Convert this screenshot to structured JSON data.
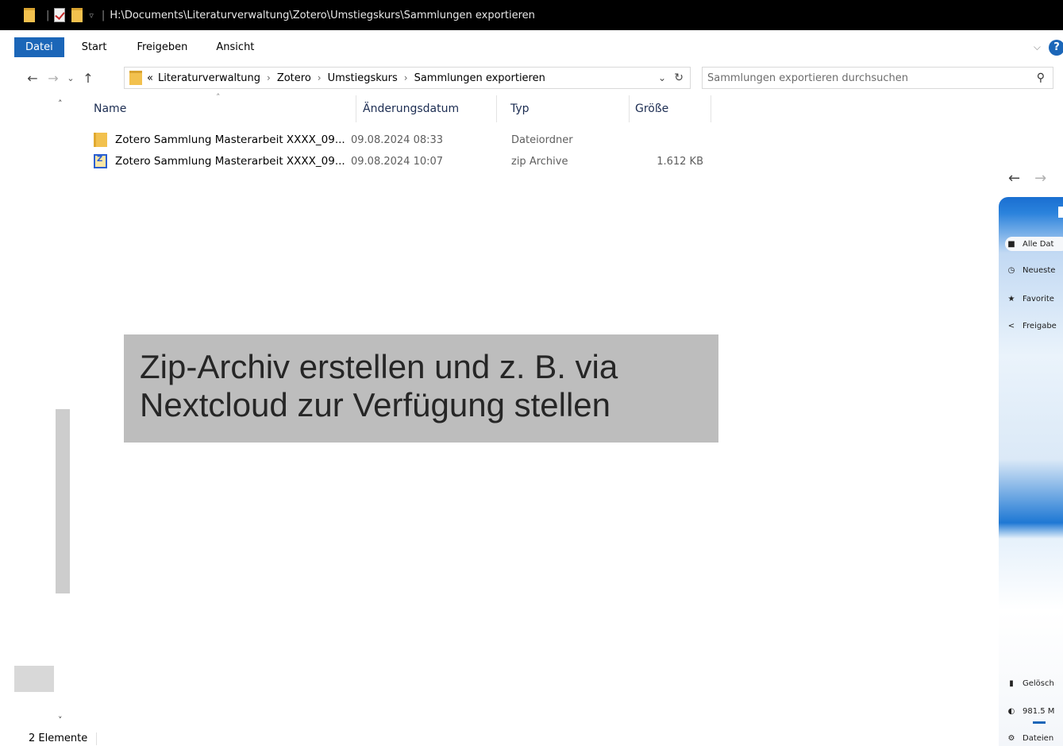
{
  "window": {
    "path": "H:\\Documents\\Literaturverwaltung\\Zotero\\Umstiegskurs\\Sammlungen exportieren"
  },
  "ribbon": {
    "tabs": [
      "Datei",
      "Start",
      "Freigeben",
      "Ansicht"
    ],
    "help": "?"
  },
  "address": {
    "overflow": "«",
    "crumbs": [
      "Literaturverwaltung",
      "Zotero",
      "Umstiegskurs",
      "Sammlungen exportieren"
    ]
  },
  "search": {
    "placeholder": "Sammlungen exportieren durchsuchen"
  },
  "columns": {
    "name": "Name",
    "date": "Änderungsdatum",
    "type": "Typ",
    "size": "Größe"
  },
  "files": [
    {
      "icon": "folder-icon",
      "name": "Zotero Sammlung Masterarbeit XXXX_09...",
      "date": "09.08.2024 08:33",
      "type": "Dateiordner",
      "size": ""
    },
    {
      "icon": "zip-archive-icon",
      "name": "Zotero Sammlung Masterarbeit XXXX_09...",
      "date": "09.08.2024 10:07",
      "type": "zip Archive",
      "size": "1.612 KB"
    }
  ],
  "callout": {
    "line1": "Zip-Archiv erstellen und z. B. via",
    "line2": "Nextcloud zur Verfügung stellen"
  },
  "status": {
    "count": "2 Elemente"
  },
  "nextcloud": {
    "items": [
      "Alle Dat",
      "Neueste",
      "Favorite",
      "Freigabe"
    ],
    "bottom": [
      "Gelösch",
      "981.5 M",
      "Dateien"
    ]
  },
  "colors": {
    "accent": "#1b66b8",
    "folder": "#f2c14e",
    "callout_bg": "#bdbdbd"
  }
}
